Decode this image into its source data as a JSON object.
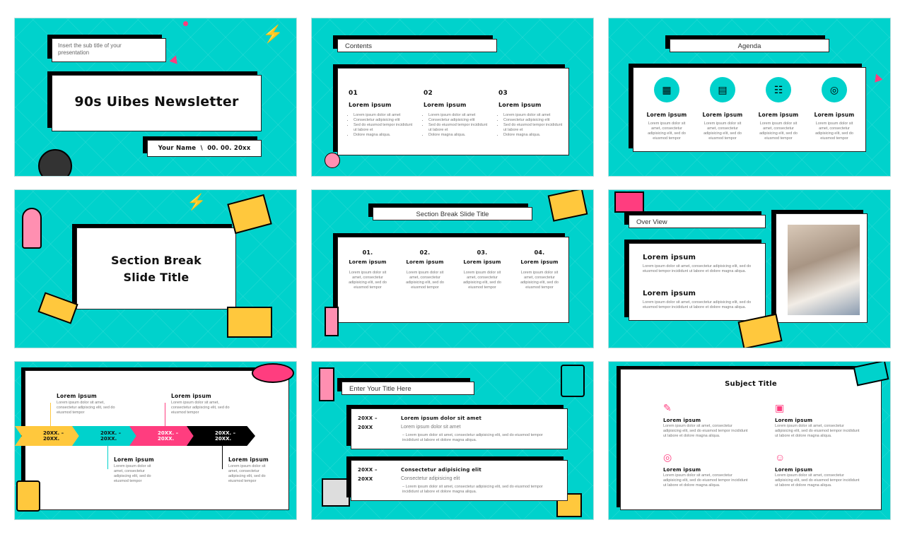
{
  "colors": {
    "teal": "#00d2cc",
    "pink": "#ff3d7f",
    "yellow": "#ffc83d",
    "black": "#000000"
  },
  "slide1": {
    "subtitle": "Insert the sub title of your presentation",
    "title": "90s Uibes Newsletter",
    "name_date": "Your Name  \\  00. 00. 20xx"
  },
  "slide2": {
    "title": "Contents",
    "columns": [
      {
        "num": "01",
        "heading": "Lorem ipsum",
        "bullets": [
          "Lorem ipsum dolor sit amet",
          "Consectetur adipisicing elit",
          "Sed do eiusmod tempor incididunt ut labore et",
          "Dolore magna aliqua."
        ]
      },
      {
        "num": "02",
        "heading": "Lorem ipsum",
        "bullets": [
          "Lorem ipsum dolor sit amet",
          "Consectetur adipisicing elit",
          "Sed do eiusmod tempor incididunt ut labore et",
          "Dolore magna aliqua."
        ]
      },
      {
        "num": "03",
        "heading": "Lorem ipsum",
        "bullets": [
          "Lorem ipsum dolor sit amet",
          "Consectetur adipisicing elit",
          "Sed do eiusmod tempor incididunt ut labore et",
          "Dolore magna aliqua."
        ]
      }
    ]
  },
  "slide3": {
    "title": "Agenda",
    "items": [
      {
        "icon": "calendar-icon",
        "glyph": "▦",
        "heading": "Lorem ipsum",
        "text": "Lorem ipsum dolor sit amet, consectetur adipisicing elit, sed do eiusmod tempor"
      },
      {
        "icon": "document-icon",
        "glyph": "▤",
        "heading": "Lorem ipsum",
        "text": "Lorem ipsum dolor sit amet, consectetur adipisicing elit, sed do eiusmod tempor"
      },
      {
        "icon": "checklist-icon",
        "glyph": "☷",
        "heading": "Lorem ipsum",
        "text": "Lorem ipsum dolor sit amet, consectetur adipisicing elit, sed do eiusmod tempor"
      },
      {
        "icon": "target-icon",
        "glyph": "◎",
        "heading": "Lorem ipsum",
        "text": "Lorem ipsum dolor sit amet, consectetur adipisicing elit, sed do eiusmod tempor"
      }
    ]
  },
  "slide4": {
    "title_line1": "Section Break",
    "title_line2": "Slide Title"
  },
  "slide5": {
    "title": "Section Break Slide Title",
    "items": [
      {
        "num": "01.",
        "heading": "Lorem ipsum",
        "text": "Lorem ipsum dolor sit amet, consectetur adipisicing elit, sed do eiusmod tempor"
      },
      {
        "num": "02.",
        "heading": "Lorem ipsum",
        "text": "Lorem ipsum dolor sit amet, consectetur adipisicing elit, sed do eiusmod tempor"
      },
      {
        "num": "03.",
        "heading": "Lorem ipsum",
        "text": "Lorem ipsum dolor sit amet, consectetur adipisicing elit, sed do eiusmod tempor"
      },
      {
        "num": "04.",
        "heading": "Lorem ipsum",
        "text": "Lorem ipsum dolor sit amet, consectetur adipisicing elit, sed do eiusmod tempor"
      }
    ]
  },
  "slide6": {
    "title": "Over View",
    "blocks": [
      {
        "heading": "Lorem ipsum",
        "text": "Lorem ipsum dolor sit amet, consectetur adipisicing elit, sed do eiusmod tempor incididunt ut labore et dolore magna aliqua."
      },
      {
        "heading": "Lorem ipsum",
        "text": "Lorem ipsum dolor sit amet, consectetur adipisicing elit, sed do eiusmod tempor incididunt ut labore et dolore magna aliqua."
      }
    ]
  },
  "slide7": {
    "steps": [
      {
        "line1": "20XX. –",
        "line2": "20XX.",
        "heading": "Lorem ipsum",
        "text": "Lorem ipsum dolor sit amet, consectetur adipiscing elit, sed do eiusmod tempor"
      },
      {
        "line1": "20XX. –",
        "line2": "20XX.",
        "heading": "Lorem ipsum",
        "text": "Lorem ipsum dolor sit amet, consectetur adipiscing elit, sed do eiusmod tempor"
      },
      {
        "line1": "20XX. –",
        "line2": "20XX.",
        "heading": "Lorem ipsum",
        "text": "Lorem ipsum dolor sit amet, consectetur adipiscing elit, sed do eiusmod tempor"
      },
      {
        "line1": "20XX. –",
        "line2": "20XX.",
        "heading": "Lorem ipsum",
        "text": "Lorem ipsum dolor sit amet, consectetur adipiscing elit, sed do eiusmod tempor"
      }
    ]
  },
  "slide8": {
    "title": "Enter Your Title Here",
    "rows": [
      {
        "years1": "20XX –",
        "years2": "20XX",
        "heading": "Lorem ipsum dolor sit amet",
        "sub": "Lorem ipsum dolor sit amet",
        "detail": "Lorem ipsum dolor sit amet, consectetur adipisicing elit, sed do eiusmod tempor incididunt ut labore et dolore magna aliqua."
      },
      {
        "years1": "20XX –",
        "years2": "20XX",
        "heading": "Consectetur adipisicing elit",
        "sub": "Consectetur adipisicing elit",
        "detail": "Lorem ipsum dolor sit amet, consectetur adipisicing elit, sed do eiusmod tempor incididunt ut labore et dolore magna aliqua."
      }
    ]
  },
  "slide9": {
    "title": "Subject Title",
    "items": [
      {
        "icon": "document-edit-icon",
        "glyph": "✎",
        "heading": "Lorem ipsum",
        "text": "Lorem ipsum dolor sit amet, consectetur adipisicing elit, sed do eiusmod tempor incididunt ut labore et dolore magna aliqua."
      },
      {
        "icon": "devices-icon",
        "glyph": "▣",
        "heading": "Lorem ipsum",
        "text": "Lorem ipsum dolor sit amet, consectetur adipisicing elit, sed do eiusmod tempor incididunt ut labore et dolore magna aliqua."
      },
      {
        "icon": "target-icon",
        "glyph": "◎",
        "heading": "Lorem ipsum",
        "text": "Lorem ipsum dolor sit amet, consectetur adipisicing elit, sed do eiusmod tempor incididunt ut labore et dolore magna aliqua."
      },
      {
        "icon": "support-agent-icon",
        "glyph": "☺",
        "heading": "Lorem ipsum",
        "text": "Lorem ipsum dolor sit amet, consectetur adipisicing elit, sed do eiusmod tempor incididunt ut labore et dolore magna aliqua."
      }
    ]
  }
}
